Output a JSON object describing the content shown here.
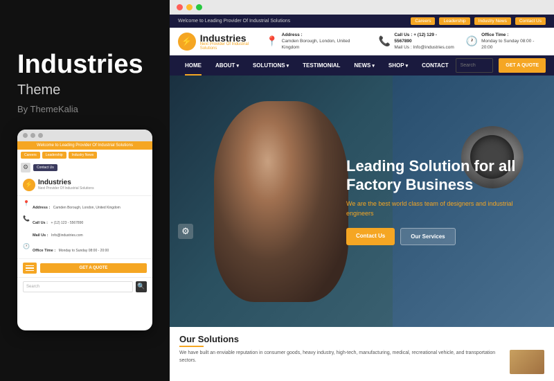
{
  "left_panel": {
    "theme_name": "Industries",
    "theme_type": "Theme",
    "author": "By ThemeKalia"
  },
  "mobile_preview": {
    "topbar_text": "Welcome to Leading Provider Of Industrial Solutions",
    "nav_buttons": [
      "Careers",
      "Leadership",
      "Industry News"
    ],
    "contact_btn": "Contact Us",
    "logo_text": "Industries",
    "logo_sub": "Next Provider Of Industrial Solutions",
    "address_label": "Address :",
    "address_value": "Camden Borough, London, United Kingdom",
    "call_label": "Call Us :",
    "call_value": "+ (12) 123 - 5567890",
    "mail_label": "Mail Us :",
    "mail_value": "Info@industries.com",
    "office_label": "Office Time :",
    "office_value": "Monday to Sunday 08:00 - 20:00",
    "cta_button": "GET A QUOTE",
    "search_placeholder": "Search"
  },
  "desktop_preview": {
    "topbar_text": "Welcome to Leading Provider Of Industrial Solutions",
    "topbar_links": [
      "Careers",
      "Leadership",
      "Industry News",
      "Contact Us"
    ],
    "logo_text": "Industries",
    "logo_sub": "Next Provider Of Industrial Solutions",
    "address_label": "Address :",
    "address_value": "Camden Borough, London, United Kingdom",
    "call_label": "Call Us :",
    "call_value": "+ (12) 129 - 5567890",
    "mail_label": "Mail Us :",
    "mail_value": "Info@industries.com",
    "office_label": "Office Time :",
    "office_value": "Monday to Sunday 08:00 - 20:00",
    "nav_items": [
      "HOME",
      "ABOUT",
      "SOLUTIONS",
      "TESTIMONIAL",
      "NEWS",
      "SHOP",
      "CONTACT"
    ],
    "nav_has_dropdown": [
      false,
      true,
      true,
      false,
      true,
      true,
      false
    ],
    "search_placeholder": "Search",
    "quote_button": "GET A QUOTE",
    "hero_title": "Leading Solution for all Factory Business",
    "hero_subtitle": "We are the best world class team of designers and industrial engineers",
    "hero_btn_contact": "Contact Us",
    "hero_btn_services": "Our Services",
    "solutions_title": "Our Solutions",
    "solutions_text": "We have built an enviable reputation in consumer goods, heavy industry, high-tech, manufacturing, medical, recreational vehicle, and transportation sectors."
  }
}
